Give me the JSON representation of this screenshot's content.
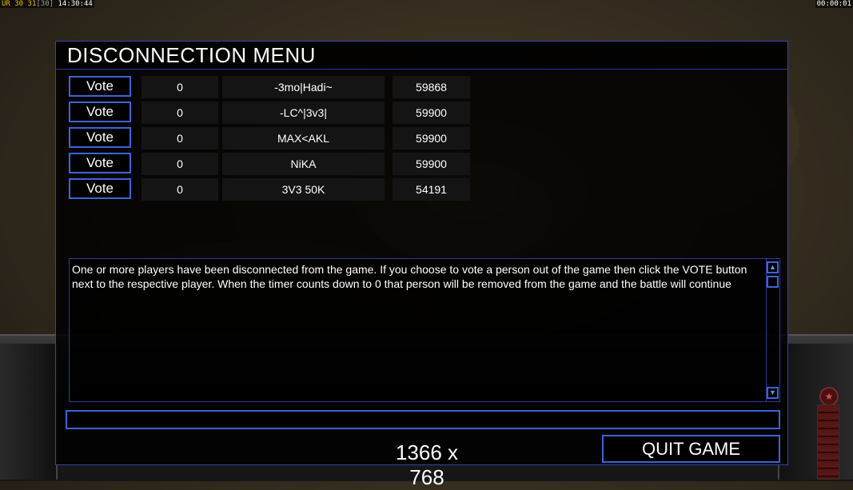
{
  "hud": {
    "left_prefix": "UR",
    "left_a": "30",
    "left_b": "31",
    "left_c": "[30]",
    "clock": "14:30:44",
    "timer": "00:00:01"
  },
  "menu": {
    "title": "DISCONNECTION MENU",
    "players": [
      {
        "vote_label": "Vote",
        "votes": "0",
        "name": "-3mo|Hadi~",
        "timeout": "59868"
      },
      {
        "vote_label": "Vote",
        "votes": "0",
        "name": "-LC^|3v3|",
        "timeout": "59900"
      },
      {
        "vote_label": "Vote",
        "votes": "0",
        "name": "MAX<AKL",
        "timeout": "59900"
      },
      {
        "vote_label": "Vote",
        "votes": "0",
        "name": "NiKA",
        "timeout": "59900"
      },
      {
        "vote_label": "Vote",
        "votes": "0",
        "name": "3V3 50K",
        "timeout": "54191"
      }
    ],
    "message": "One or more players have been disconnected from the game. If you choose to vote a person out of the game then click the VOTE button next to the respective player. When the timer counts down to 0 that person will be removed from the game and the battle will continue",
    "chat_value": "",
    "resolution": "1366 x 768",
    "quit_label": "QUIT GAME"
  },
  "icons": {
    "scroll_up": "triangle-up-icon",
    "scroll_down": "triangle-down-icon",
    "rank": "star-icon"
  },
  "colors": {
    "accent": "#3d63d8",
    "panel": "#000000",
    "cell": "#141414"
  }
}
